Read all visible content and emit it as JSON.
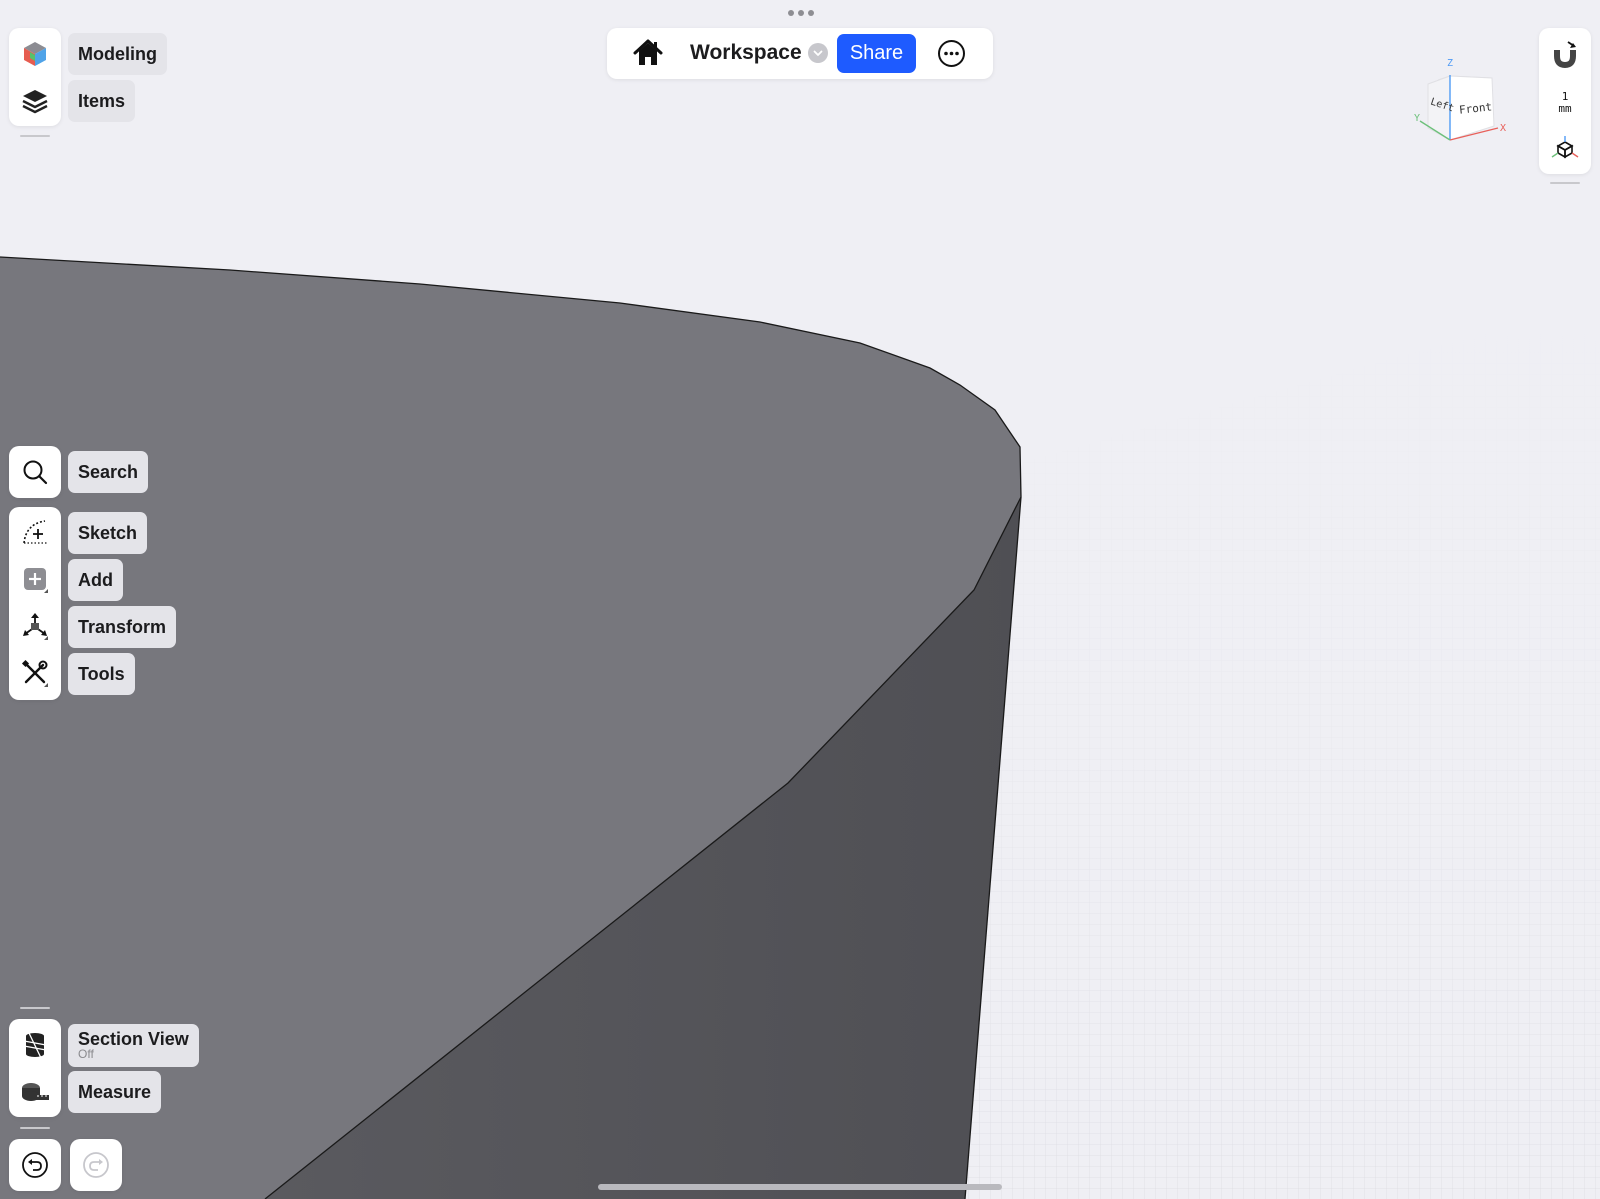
{
  "top_bar": {
    "workspace_title": "Workspace",
    "share_label": "Share",
    "home_icon": "house-icon",
    "more_icon": "ellipsis-circle-icon",
    "dropdown_icon": "chevron-down-icon"
  },
  "left_top_panel": {
    "items": [
      {
        "label": "Modeling",
        "icon": "colored-cube-icon"
      },
      {
        "label": "Items",
        "icon": "layers-icon"
      }
    ]
  },
  "search": {
    "label": "Search",
    "icon": "magnifier-icon"
  },
  "tools_panel": {
    "items": [
      {
        "label": "Sketch",
        "icon": "sketch-arc-icon"
      },
      {
        "label": "Add",
        "icon": "plus-square-icon"
      },
      {
        "label": "Transform",
        "icon": "move-arrows-icon"
      },
      {
        "label": "Tools",
        "icon": "wrench-screwdriver-icon"
      }
    ]
  },
  "bottom_panel": {
    "section_view": {
      "label": "Section View",
      "status": "Off",
      "icon": "section-view-icon"
    },
    "measure": {
      "label": "Measure",
      "icon": "tape-measure-icon"
    }
  },
  "history": {
    "undo_icon": "undo-icon",
    "redo_icon": "redo-icon"
  },
  "right_panel": {
    "snap_icon": "magnet-icon",
    "grid_size_value": "1",
    "grid_size_unit": "mm",
    "view_icon": "axes-cube-icon"
  },
  "view_cube": {
    "front_label": "Front",
    "left_label": "Left",
    "z_label": "Z",
    "x_label": "X",
    "y_label": "Y",
    "x_color": "#e8615b",
    "y_color": "#6cc07a",
    "z_color": "#4f9bf5"
  },
  "colors": {
    "background": "#efeff4",
    "accent": "#1e5bff",
    "model_top": "#77777d",
    "model_side": "#545459"
  }
}
